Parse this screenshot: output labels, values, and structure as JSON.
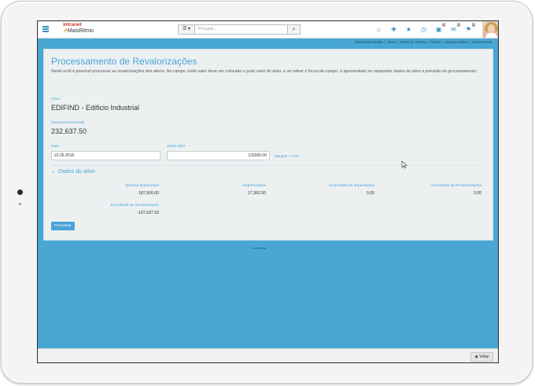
{
  "header": {
    "logo_top": "intranet",
    "logo_bottom": "MaisRitmo",
    "search_placeholder": "Procurar...",
    "badges": {
      "inbox": "0",
      "messages": "0",
      "alerts": "0"
    }
  },
  "breadcrumb": {
    "items": [
      "Dashboard Gestão",
      "Ativos",
      "Pedido de Tarefas",
      "Tarefas",
      "Importar Dados",
      "Guitarra 2018"
    ]
  },
  "page": {
    "title": "Processamento de Revalorizações",
    "description": "Neste ecrã é possível processar as revalorizações dos ativos. No campo Justo valor deve ser colocado o justo valor do ativo, e ao retirar o focus do campo, é apresentado no separador dados do ativo a previsão do processamento."
  },
  "form": {
    "ativo_label": "Ativo",
    "ativo_value": "EDIFIND - Edificio Industrial",
    "quantia_label": "Quantia Escriturada",
    "quantia_value": "232,637.50",
    "data_label": "Data",
    "data_value": "22.06.2018",
    "justo_label": "Justo Valor",
    "justo_value": "125000.00",
    "margin_text": "Margem = 0.54"
  },
  "section": {
    "title": "Dados do ativo",
    "fields": [
      {
        "label": "Quantia depreciável",
        "value": "187,500.00"
      },
      {
        "label": "Depreciações",
        "value": "17,362.50"
      },
      {
        "label": "Acumulado de Imparidades",
        "value": "0.00"
      },
      {
        "label": "Acumulado de Revalorizações",
        "value": "0.00"
      }
    ],
    "excedente_label": "Excedente de Revalorização",
    "excedente_value": "-107,637.50"
  },
  "actions": {
    "process_label": "Processar",
    "back_label": "Voltar"
  },
  "footer": {
    "powered": "Powered by"
  },
  "colors": {
    "accent": "#4aa3d8",
    "background": "#48a8d3",
    "panel": "#ecf0f1"
  }
}
